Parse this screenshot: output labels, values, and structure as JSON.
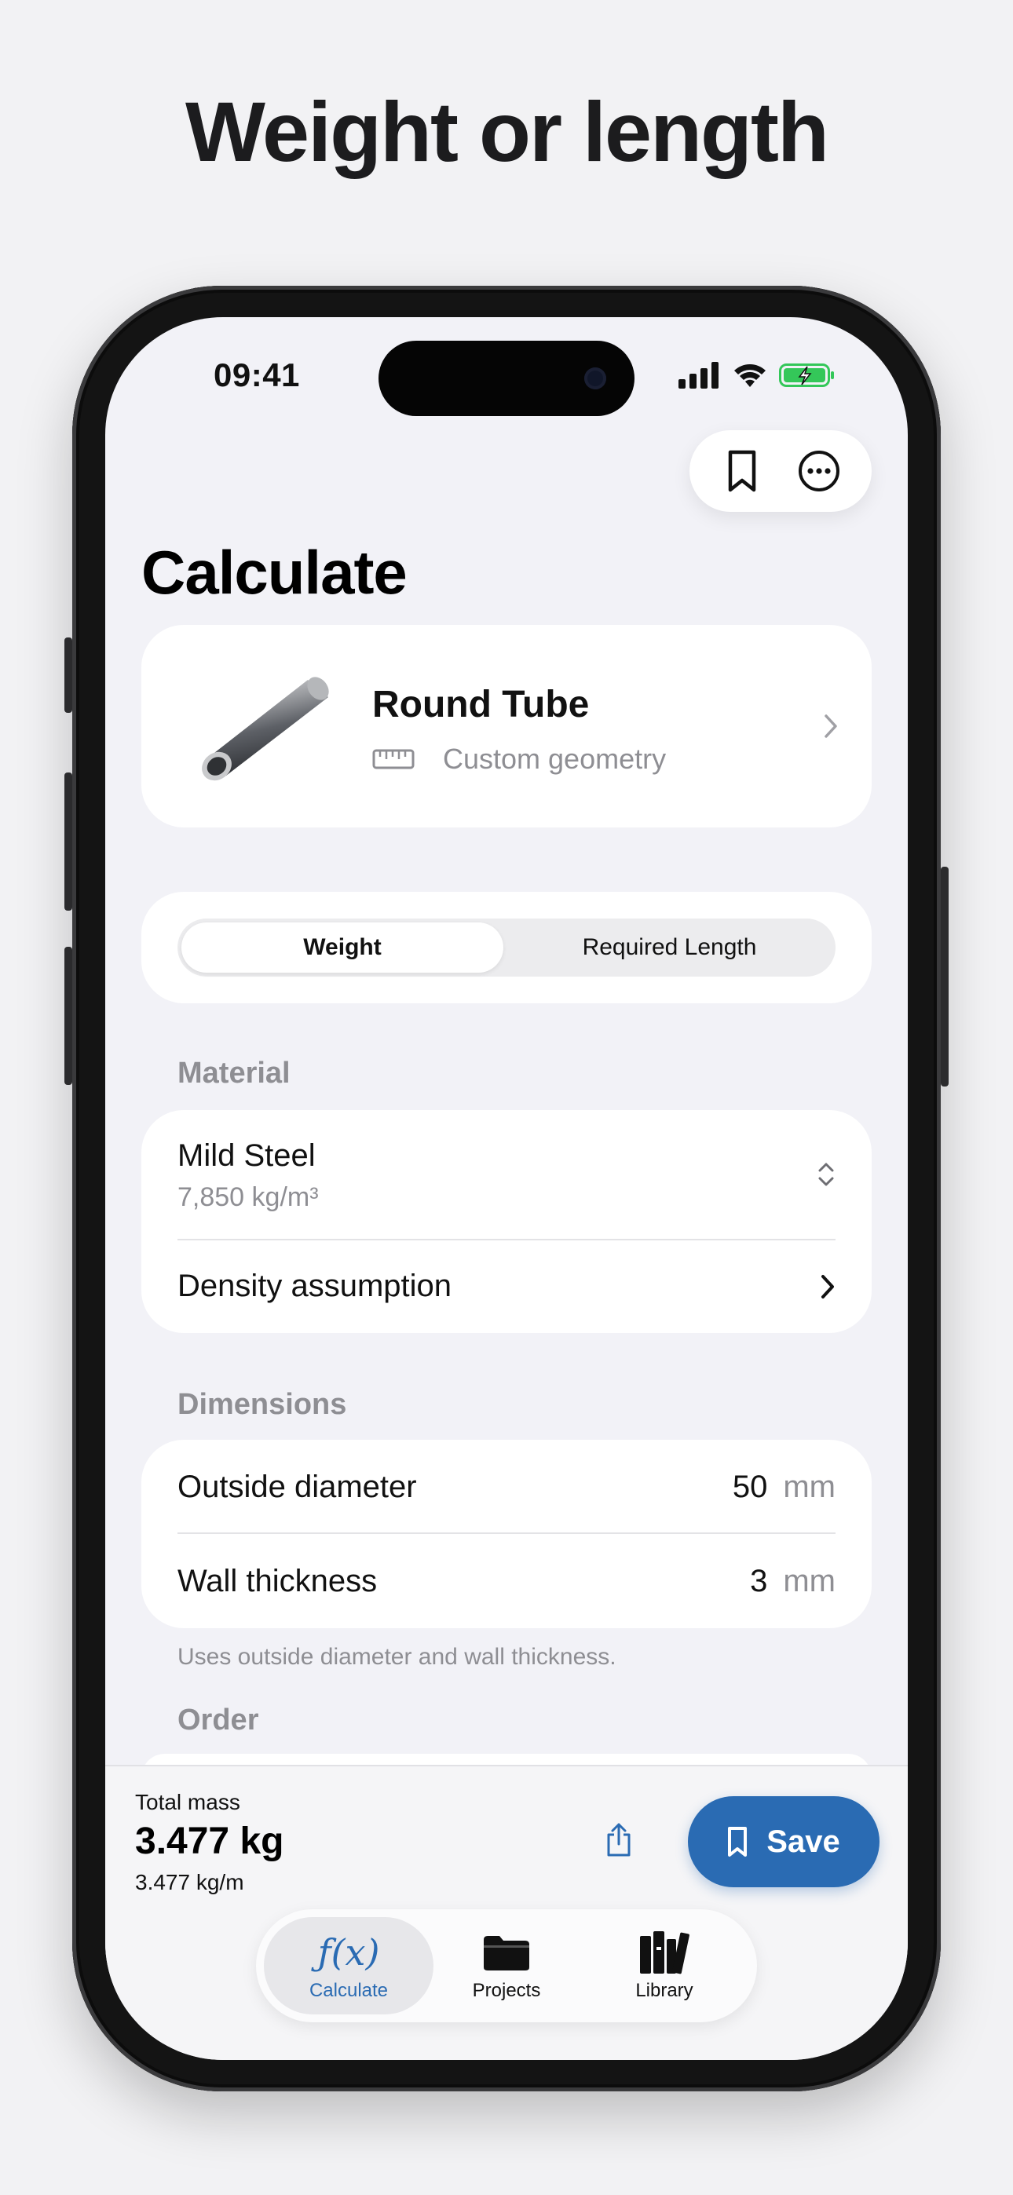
{
  "marketing": {
    "headline": "Weight or length"
  },
  "status_bar": {
    "time": "09:41"
  },
  "page": {
    "title": "Calculate"
  },
  "shape": {
    "name": "Round Tube",
    "subtitle": "Custom geometry"
  },
  "mode": {
    "options": [
      "Weight",
      "Required Length"
    ],
    "selected": "Weight"
  },
  "material": {
    "section_label": "Material",
    "name": "Mild Steel",
    "density": "7,850 kg/m³",
    "density_assumption_label": "Density assumption"
  },
  "dimensions": {
    "section_label": "Dimensions",
    "rows": [
      {
        "label": "Outside diameter",
        "value": "50",
        "unit": "mm"
      },
      {
        "label": "Wall thickness",
        "value": "3",
        "unit": "mm"
      }
    ],
    "hint": "Uses outside diameter and wall thickness."
  },
  "order": {
    "section_label": "Order"
  },
  "result": {
    "label": "Total mass",
    "value": "3.477 kg",
    "per_length": "3.477 kg/m"
  },
  "actions": {
    "save_label": "Save"
  },
  "tabs": [
    {
      "label": "Calculate",
      "icon": "function-icon",
      "active": true
    },
    {
      "label": "Projects",
      "icon": "folder-icon",
      "active": false
    },
    {
      "label": "Library",
      "icon": "books-icon",
      "active": false
    }
  ],
  "colors": {
    "accent": "#2a6bb3",
    "background": "#f2f2f7",
    "battery": "#34c759"
  }
}
